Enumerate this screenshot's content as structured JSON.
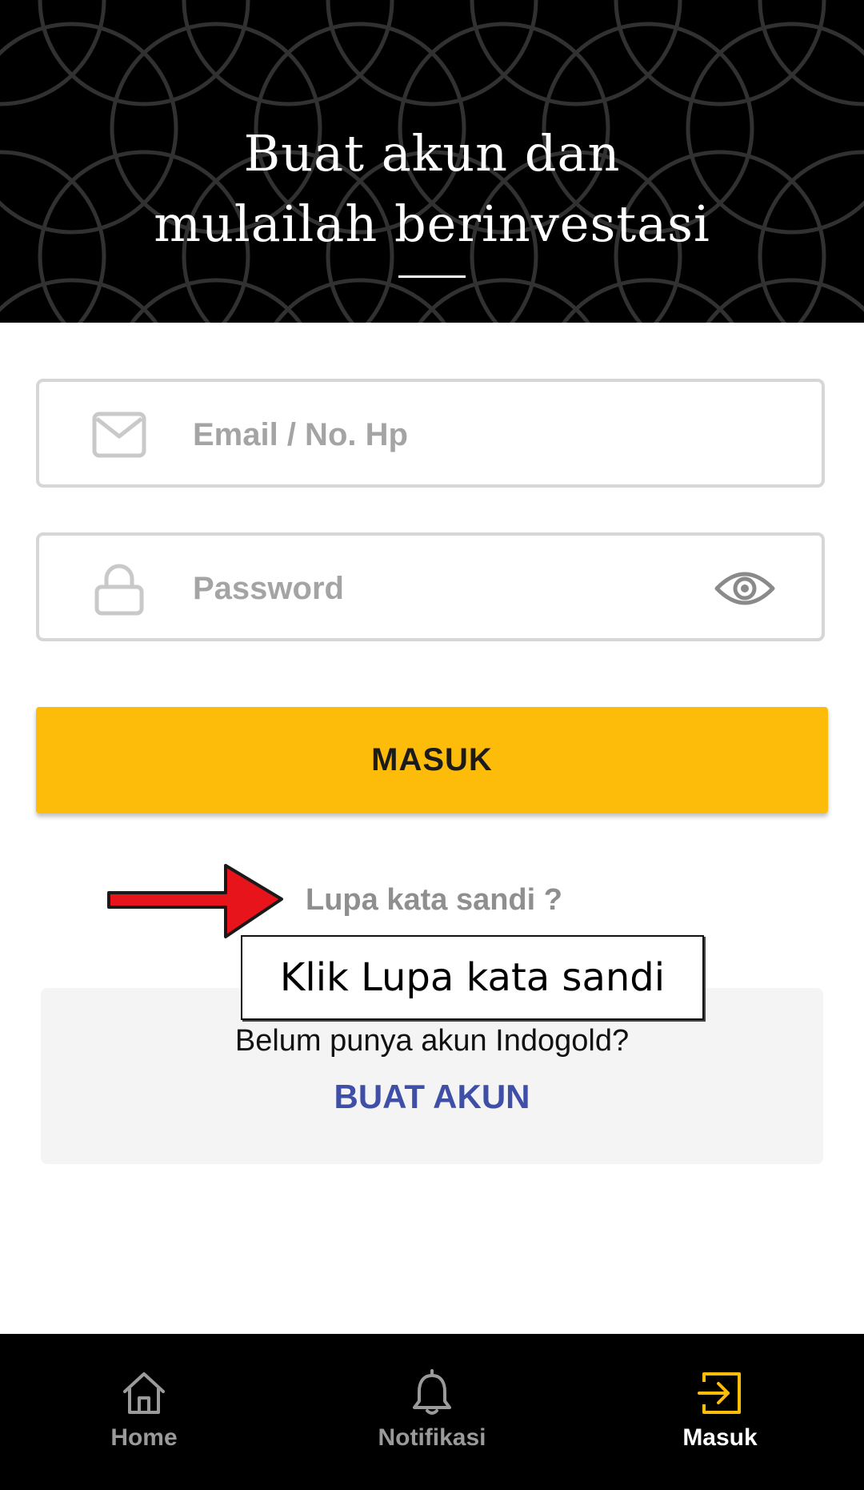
{
  "header": {
    "title_line1": "Buat akun dan",
    "title_line2": "mulailah berinvestasi"
  },
  "login_form": {
    "email_placeholder": "Email / No. Hp",
    "email_value": "",
    "password_placeholder": "Password",
    "password_value": "",
    "submit_label": "MASUK",
    "forgot_label": "Lupa kata sandi ?"
  },
  "annotation": {
    "callout_text": "Klik Lupa kata sandi"
  },
  "register": {
    "question": "Belum punya akun Indogold?",
    "link_label": "BUAT AKUN"
  },
  "bottom_nav": {
    "items": [
      {
        "label": "Home",
        "icon": "home-icon",
        "active": false
      },
      {
        "label": "Notifikasi",
        "icon": "bell-icon",
        "active": false
      },
      {
        "label": "Masuk",
        "icon": "login-icon",
        "active": true
      }
    ]
  },
  "colors": {
    "header_bg": "#000000",
    "accent_yellow": "#fdbb0a",
    "link_blue": "#3f4fa8",
    "annotation_red": "#e8141b"
  }
}
